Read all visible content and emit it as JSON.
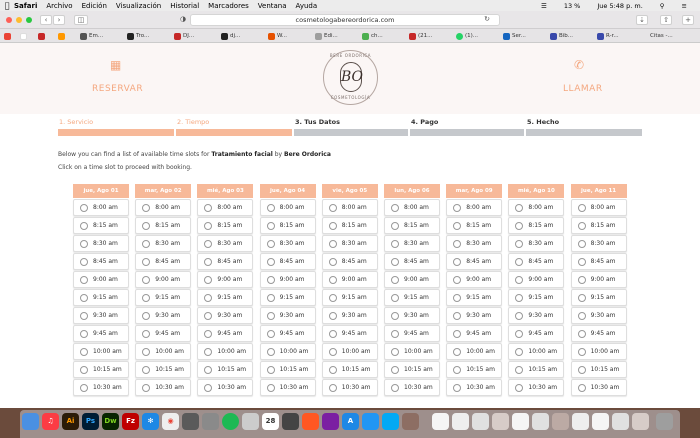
{
  "menubar": {
    "app": "Safari",
    "items": [
      "Archivo",
      "Edición",
      "Visualización",
      "Historial",
      "Marcadores",
      "Ventana",
      "Ayuda"
    ],
    "battery": "13 %",
    "clock": "Jue 5:48 p. m."
  },
  "browser": {
    "url": "cosmetologabereordorica.com"
  },
  "bookmarks": [
    {
      "label": "",
      "color": "#ea4335"
    },
    {
      "label": "",
      "color": "#c62828"
    },
    {
      "label": "",
      "color": "#ff9800"
    },
    {
      "label": "Em...",
      "color": "#555555"
    },
    {
      "label": "Tro...",
      "color": "#222222"
    },
    {
      "label": "DJ...",
      "color": "#c62828"
    },
    {
      "label": "dj...",
      "color": "#222222"
    },
    {
      "label": "W...",
      "color": "#e65100"
    },
    {
      "label": "Edi...",
      "color": "#9e9e9e"
    },
    {
      "label": "ch...",
      "color": "#4caf50"
    },
    {
      "label": "(21...",
      "color": "#c62828"
    },
    {
      "label": "(1)...",
      "color": "#25d366"
    },
    {
      "label": "Ser...",
      "color": "#1565c0"
    },
    {
      "label": "Bib...",
      "color": "#3949ab"
    },
    {
      "label": "R-r...",
      "color": "#3949ab"
    },
    {
      "label": "Citas -...",
      "color": "#9e9e9e"
    }
  ],
  "header": {
    "reserve_label": "RESERVAR",
    "call_label": "LLAMAR",
    "logo_text_top": "BERE ORDORICA",
    "logo_text_bottom": "COSMETOLOGÍA",
    "logo_letters": "BO",
    "accent": "#f4a77f"
  },
  "steps": [
    {
      "label": "1. Servicio",
      "state": "done"
    },
    {
      "label": "2. Tiempo",
      "state": "done"
    },
    {
      "label": "3. Tus Datos",
      "state": "todo"
    },
    {
      "label": "4. Pago",
      "state": "todo"
    },
    {
      "label": "5. Hecho",
      "state": "todo"
    }
  ],
  "intro": {
    "line1_prefix": "Below you can find a list of available time slots for",
    "service": "Tratamiento facial",
    "line1_mid": "by",
    "provider": "Bere Ordorica",
    "line2": "Click on a time slot to proceed with booking."
  },
  "days": [
    "jue, Ago 01",
    "mar, Ago 02",
    "mié, Ago 03",
    "jue, Ago 04",
    "vie, Ago 05",
    "lun, Ago 06",
    "mar, Ago 09",
    "mié, Ago 10",
    "jue, Ago 11"
  ],
  "times": [
    "8:00 am",
    "8:15 am",
    "8:30 am",
    "8:45 am",
    "9:00 am",
    "9:15 am",
    "9:30 am",
    "9:45 am",
    "10:00 am",
    "10:15 am",
    "10:30 am"
  ],
  "colors": {
    "done": "#f7b999",
    "todo": "#c5c8cc",
    "done_text": "#f4a77f",
    "todo_text": "#333333"
  }
}
